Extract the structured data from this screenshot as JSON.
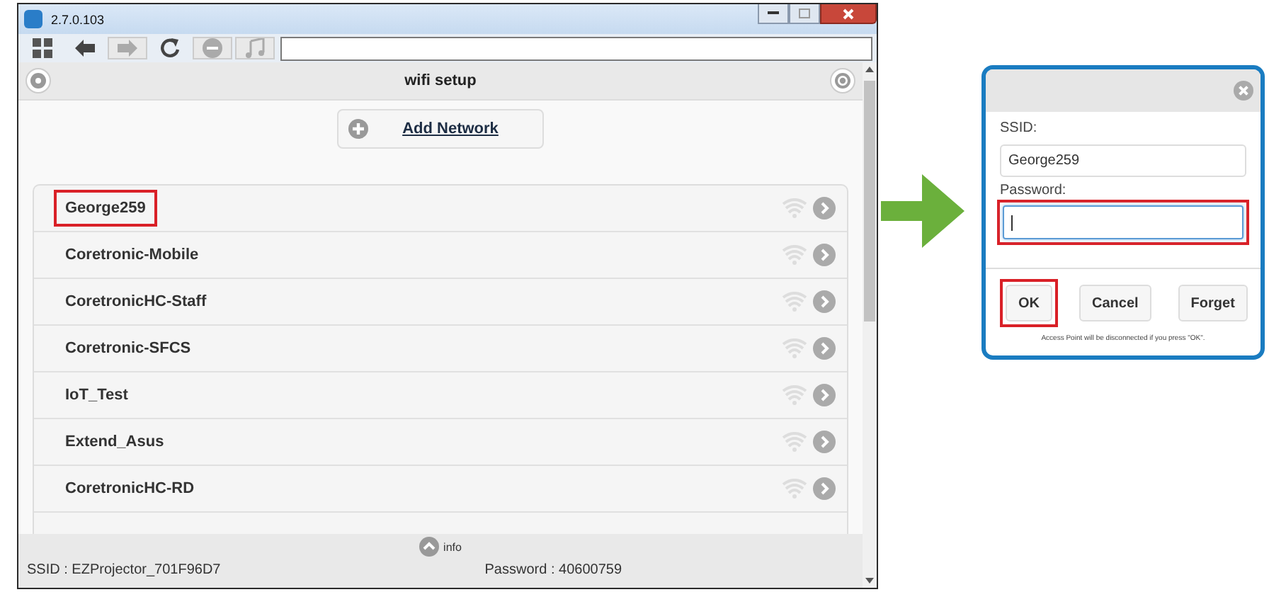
{
  "window": {
    "title": "2.7.0.103"
  },
  "toolbar": [
    {
      "kind": "grid",
      "disabled": false
    },
    {
      "kind": "back",
      "disabled": false
    },
    {
      "kind": "forward",
      "disabled": true
    },
    {
      "kind": "refresh",
      "disabled": false
    },
    {
      "kind": "stop",
      "disabled": true
    },
    {
      "kind": "music",
      "disabled": true
    }
  ],
  "header": {
    "title": "wifi setup"
  },
  "add_network": {
    "label": "Add Network"
  },
  "networks": [
    {
      "name": "George259",
      "highlighted": true
    },
    {
      "name": "Coretronic-Mobile",
      "highlighted": false
    },
    {
      "name": "CoretronicHC-Staff",
      "highlighted": false
    },
    {
      "name": "Coretronic-SFCS",
      "highlighted": false
    },
    {
      "name": "IoT_Test",
      "highlighted": false
    },
    {
      "name": "Extend_Asus",
      "highlighted": false
    },
    {
      "name": "CoretronicHC-RD",
      "highlighted": false
    }
  ],
  "footer": {
    "info": "info",
    "ssid": "SSID : EZProjector_701F96D7",
    "password": "Password : 40600759"
  },
  "dialog": {
    "ssid_label": "SSID:",
    "ssid_value": "George259",
    "password_label": "Password:",
    "password_highlighted": true,
    "buttons": [
      {
        "label": "OK",
        "highlighted": true
      },
      {
        "label": "Cancel",
        "highlighted": false
      },
      {
        "label": "Forget",
        "highlighted": false
      }
    ],
    "note": "Access Point will be disconnected if you press \"OK\"."
  }
}
